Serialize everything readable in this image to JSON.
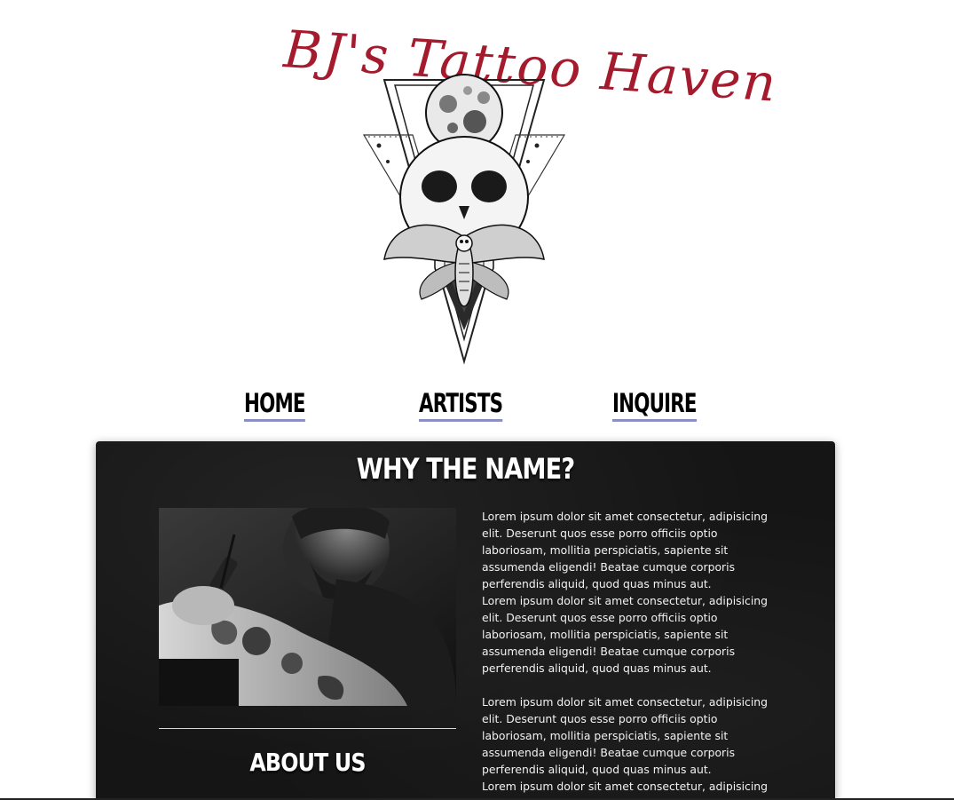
{
  "brand": {
    "title": "BJ's Tattoo Haven",
    "title_color": "#a51b2e",
    "logo_icon": "skull-moth-moon-triangle-emblem"
  },
  "nav": {
    "items": [
      {
        "label": "HOME"
      },
      {
        "label": "ARTISTS"
      },
      {
        "label": "INQUIRE"
      }
    ],
    "underline_color": "#8b8fc2"
  },
  "section": {
    "title": "WHY THE NAME?",
    "photo_icon": "tattoo-artist-photo",
    "about_title": "ABOUT US",
    "paragraphs": [
      "Lorem ipsum dolor sit amet consectetur, adipisicing elit. Deserunt quos esse porro officiis optio laboriosam, mollitia perspiciatis, sapiente sit assumenda eligendi! Beatae cumque corporis perferendis aliquid, quod quas minus aut.",
      "Lorem ipsum dolor sit amet consectetur, adipisicing elit. Deserunt quos esse porro officiis optio laboriosam, mollitia perspiciatis, sapiente sit assumenda eligendi! Beatae cumque corporis perferendis aliquid, quod quas minus aut.",
      "Lorem ipsum dolor sit amet consectetur, adipisicing elit. Deserunt quos esse porro officiis optio laboriosam, mollitia perspiciatis, sapiente sit assumenda eligendi! Beatae cumque corporis perferendis aliquid, quod quas minus aut.",
      "Lorem ipsum dolor sit amet consectetur, adipisicing"
    ],
    "panel_color": "#151515"
  }
}
